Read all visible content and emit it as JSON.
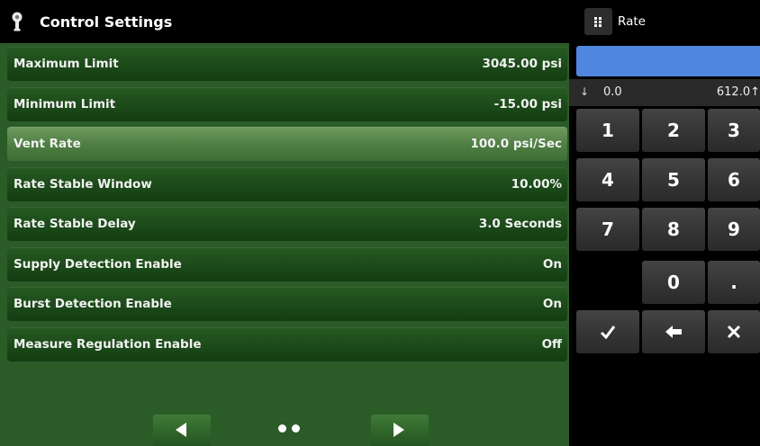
{
  "header": {
    "title": "Control Settings",
    "icon": "sensor-icon"
  },
  "settings": [
    {
      "label": "Maximum Limit",
      "value": "3045.00 psi",
      "active": false
    },
    {
      "label": "Minimum Limit",
      "value": "-15.00 psi",
      "active": false
    },
    {
      "label": "Vent Rate",
      "value": "100.0 psi/Sec",
      "active": true
    },
    {
      "label": "Rate Stable Window",
      "value": "10.00%",
      "active": false
    },
    {
      "label": "Rate Stable Delay",
      "value": "3.0 Seconds",
      "active": false
    },
    {
      "label": "Supply Detection Enable",
      "value": "On",
      "active": false
    },
    {
      "label": "Burst Detection Enable",
      "value": "On",
      "active": false
    },
    {
      "label": "Measure Regulation Enable",
      "value": "Off",
      "active": false
    }
  ],
  "pager": {
    "prev_icon": "triangle-left-icon",
    "next_icon": "triangle-right-icon",
    "page_count": 2
  },
  "keypad": {
    "title": "Rate",
    "menu_icon": "grid-menu-icon",
    "entry_value": "",
    "range": {
      "low_arrow": "↓",
      "low": "0.0",
      "high": "612.0↑"
    },
    "keys": [
      "1",
      "2",
      "3",
      "4",
      "5",
      "6",
      "7",
      "8",
      "9",
      "0",
      "."
    ],
    "actions": {
      "confirm_icon": "checkmark-icon",
      "backspace_icon": "backspace-arrow-icon",
      "cancel_icon": "close-icon"
    }
  },
  "colors": {
    "panel_green": "#2b5c28",
    "row_green": "#1c4a19",
    "row_active": "#5a8a4e",
    "entry_blue": "#4f86e0",
    "key_gray": "#333333"
  }
}
